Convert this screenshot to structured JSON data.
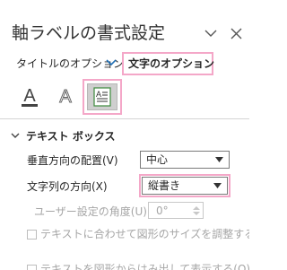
{
  "pane": {
    "title": "軸ラベルの書式設定",
    "dropdown_icon": "chevron-down-icon",
    "close_icon": "close-icon"
  },
  "tabs": {
    "title_options": "タイトルのオプション",
    "text_options": "文字のオプション"
  },
  "icons": {
    "fill": "text-fill-outline-icon",
    "effects": "text-effects-icon",
    "textbox": "textbox-icon"
  },
  "section": {
    "title": "テキスト ボックス"
  },
  "fields": {
    "vertical_align_label": "垂直方向の配置(V)",
    "vertical_align_value": "中心",
    "text_direction_label": "文字列の方向(X)",
    "text_direction_value": "縦書き",
    "custom_angle_label": "ユーザー設定の角度(U)",
    "custom_angle_value": "0°",
    "autofit_label": "テキストに合わせて図形のサイズを調整する",
    "overflow_label": "テキストを図形からはみ出して表示する(O)"
  },
  "colors": {
    "highlight": "#f4a7c8",
    "accent": "#1f6fb5",
    "disabled_text": "#a6a6a6"
  }
}
